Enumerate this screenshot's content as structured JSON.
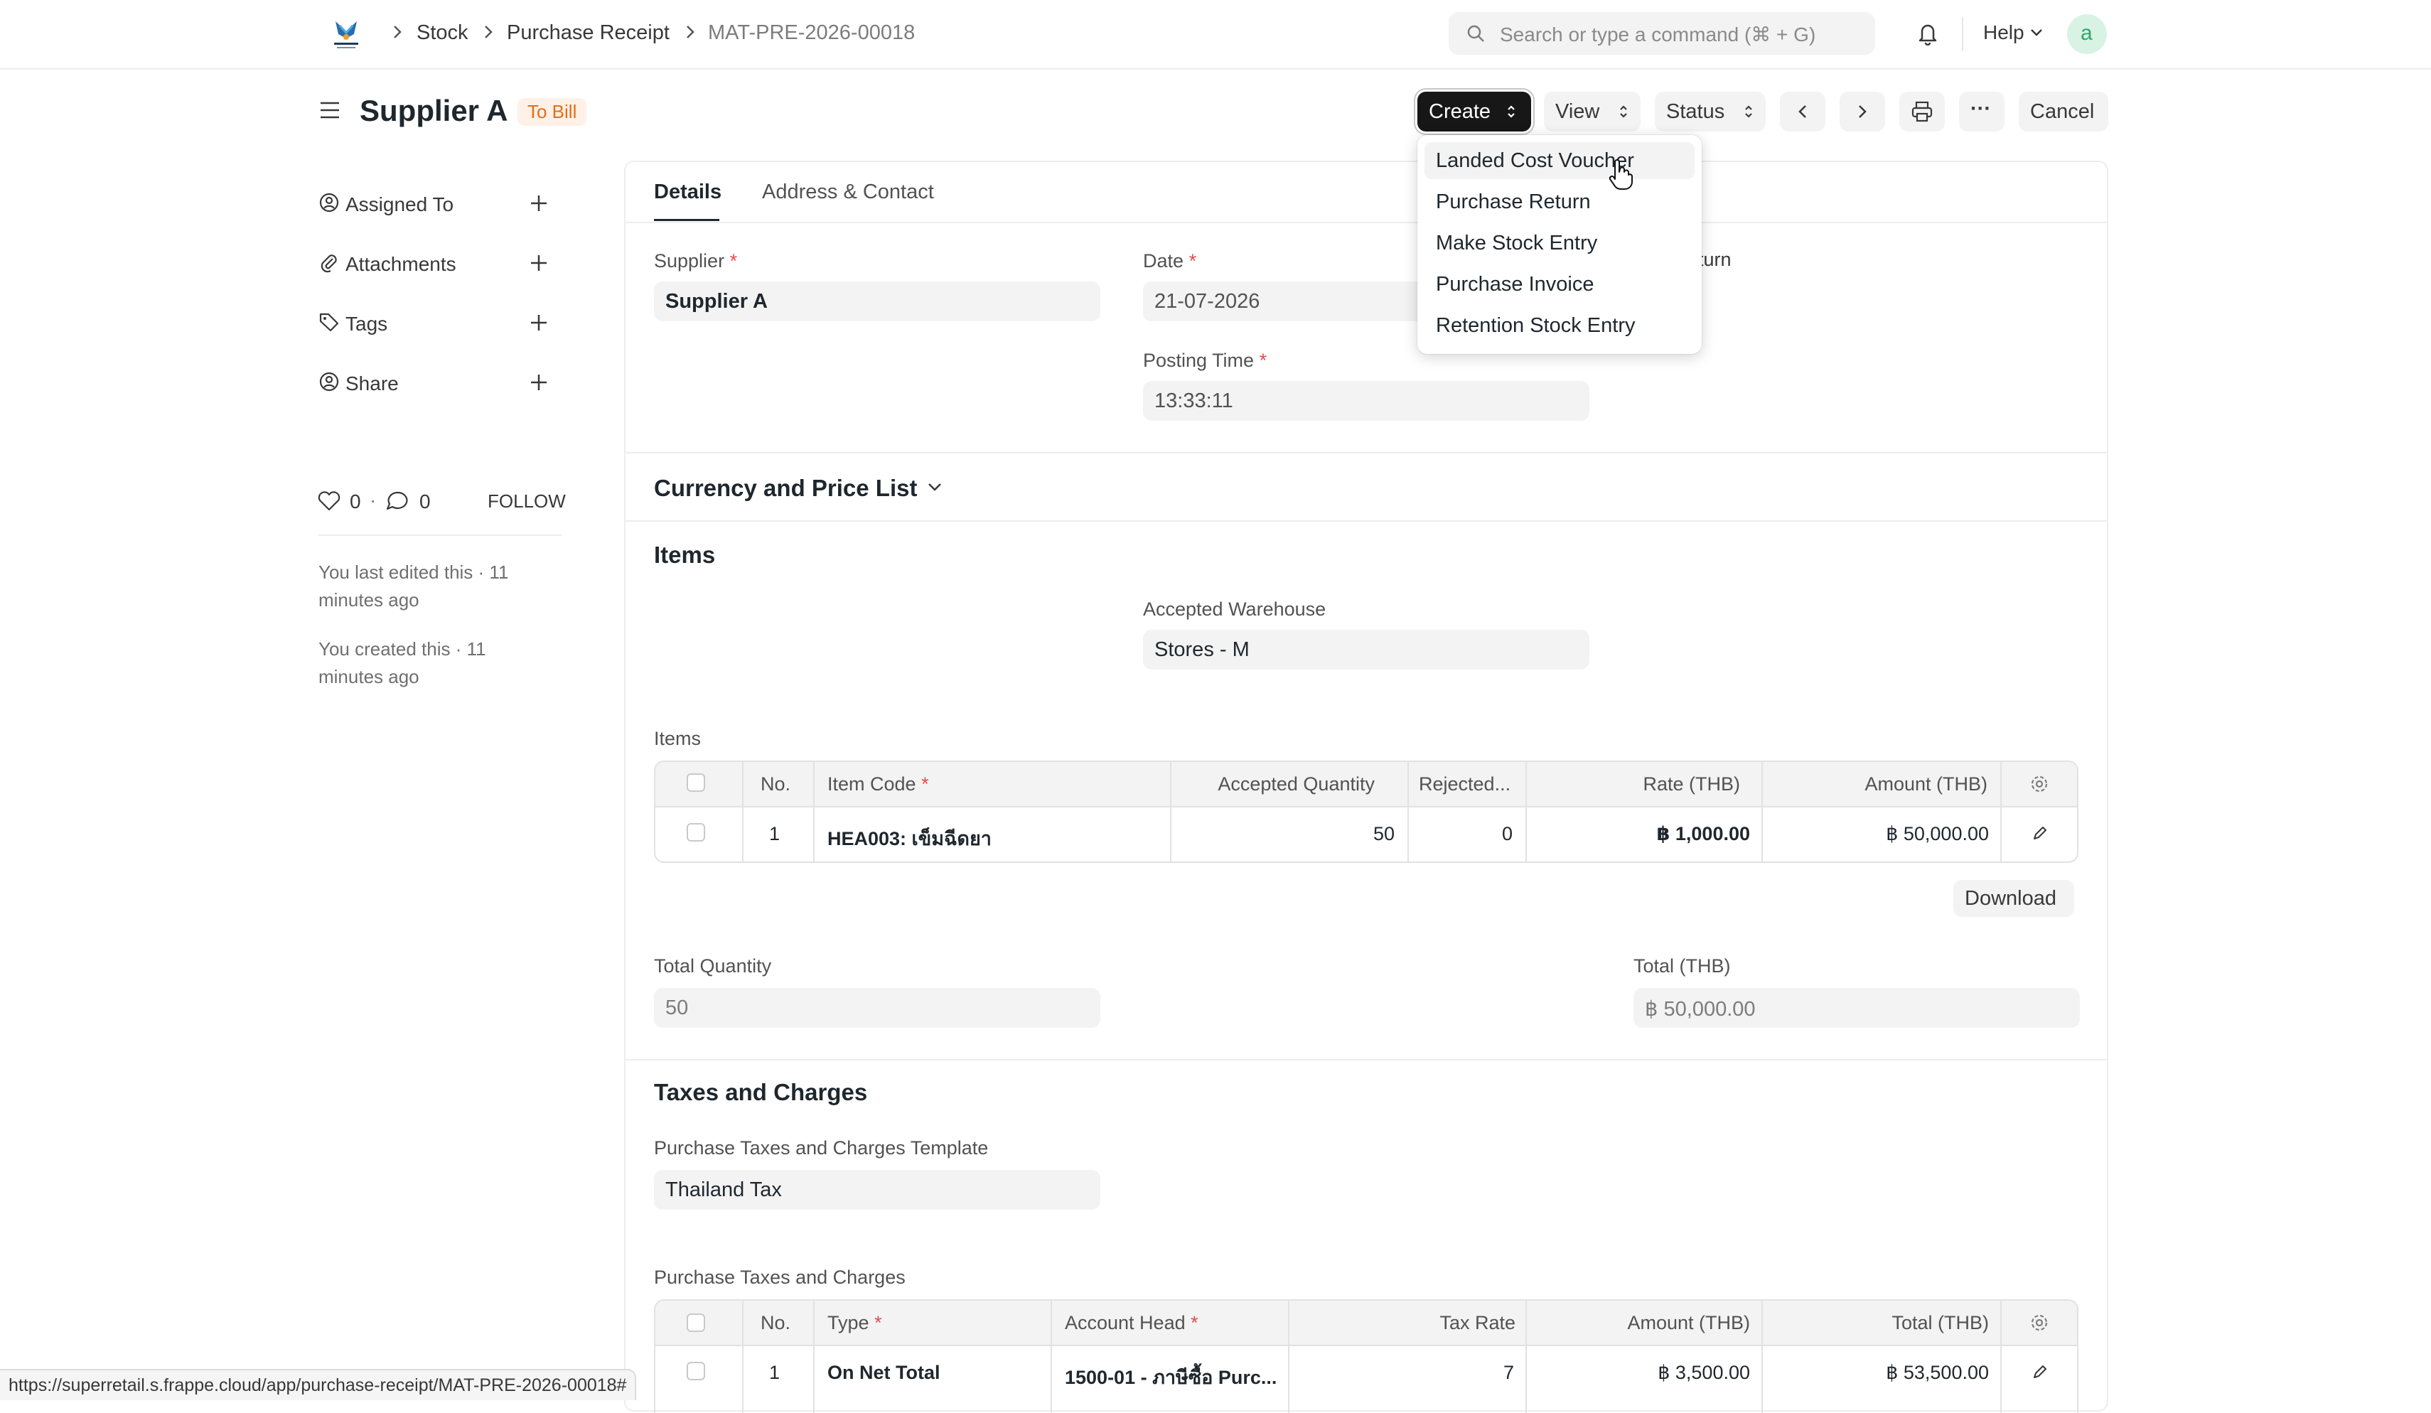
{
  "nav": {
    "breadcrumbs": [
      "Stock",
      "Purchase Receipt",
      "MAT-PRE-2026-00018"
    ],
    "search_placeholder": "Search or type a command (⌘ + G)",
    "help_label": "Help",
    "avatar_letter": "a"
  },
  "header": {
    "title": "Supplier A",
    "status_badge": "To Bill",
    "buttons": {
      "create": "Create",
      "view": "View",
      "status": "Status",
      "more": "···",
      "cancel": "Cancel"
    }
  },
  "sidebar": {
    "items": [
      {
        "label": "Assigned To"
      },
      {
        "label": "Attachments"
      },
      {
        "label": "Tags"
      },
      {
        "label": "Share"
      }
    ],
    "likes": "0",
    "comments": "0",
    "follow": "FOLLOW",
    "activity": [
      "You last edited this · 11 minutes ago",
      "You created this · 11 minutes ago"
    ]
  },
  "tabs": [
    "Details",
    "Address & Contact"
  ],
  "details": {
    "supplier_label": "Supplier",
    "supplier_value": "Supplier A",
    "date_label": "Date",
    "date_value": "21-07-2026",
    "posting_time_label": "Posting Time",
    "posting_time_value": "13:33:11",
    "partial_label": "eturn"
  },
  "currency_section": "Currency and Price List",
  "items_section": {
    "title": "Items",
    "warehouse_label": "Accepted Warehouse",
    "warehouse_value": "Stores - M",
    "table_label": "Items",
    "columns": [
      "No.",
      "Item Code",
      "Accepted Quantity",
      "Rejected...",
      "Rate (THB)",
      "Amount (THB)"
    ],
    "rows": [
      {
        "no": "1",
        "item_code": "HEA003: เข็มฉีดยา",
        "accepted_qty": "50",
        "rejected": "0",
        "rate": "฿ 1,000.00",
        "amount": "฿ 50,000.00"
      }
    ],
    "download": "Download",
    "total_qty_label": "Total Quantity",
    "total_qty_value": "50",
    "total_label": "Total (THB)",
    "total_value": "฿ 50,000.00"
  },
  "taxes_section": {
    "title": "Taxes and Charges",
    "template_label": "Purchase Taxes and Charges Template",
    "template_value": "Thailand Tax",
    "table_label": "Purchase Taxes and Charges",
    "columns": [
      "No.",
      "Type",
      "Account Head",
      "Tax Rate",
      "Amount (THB)",
      "Total (THB)"
    ],
    "rows": [
      {
        "no": "1",
        "type": "On Net Total",
        "account_head": "1500-01 - ภาษีซื้อ Purc...",
        "tax_rate": "7",
        "amount": "฿ 3,500.00",
        "total": "฿ 53,500.00"
      }
    ]
  },
  "create_menu": {
    "items": [
      "Landed Cost Voucher",
      "Purchase Return",
      "Make Stock Entry",
      "Purchase Invoice",
      "Retention Stock Entry"
    ]
  },
  "status_url": "https://superretail.s.frappe.cloud/app/purchase-receipt/MAT-PRE-2026-00018#"
}
